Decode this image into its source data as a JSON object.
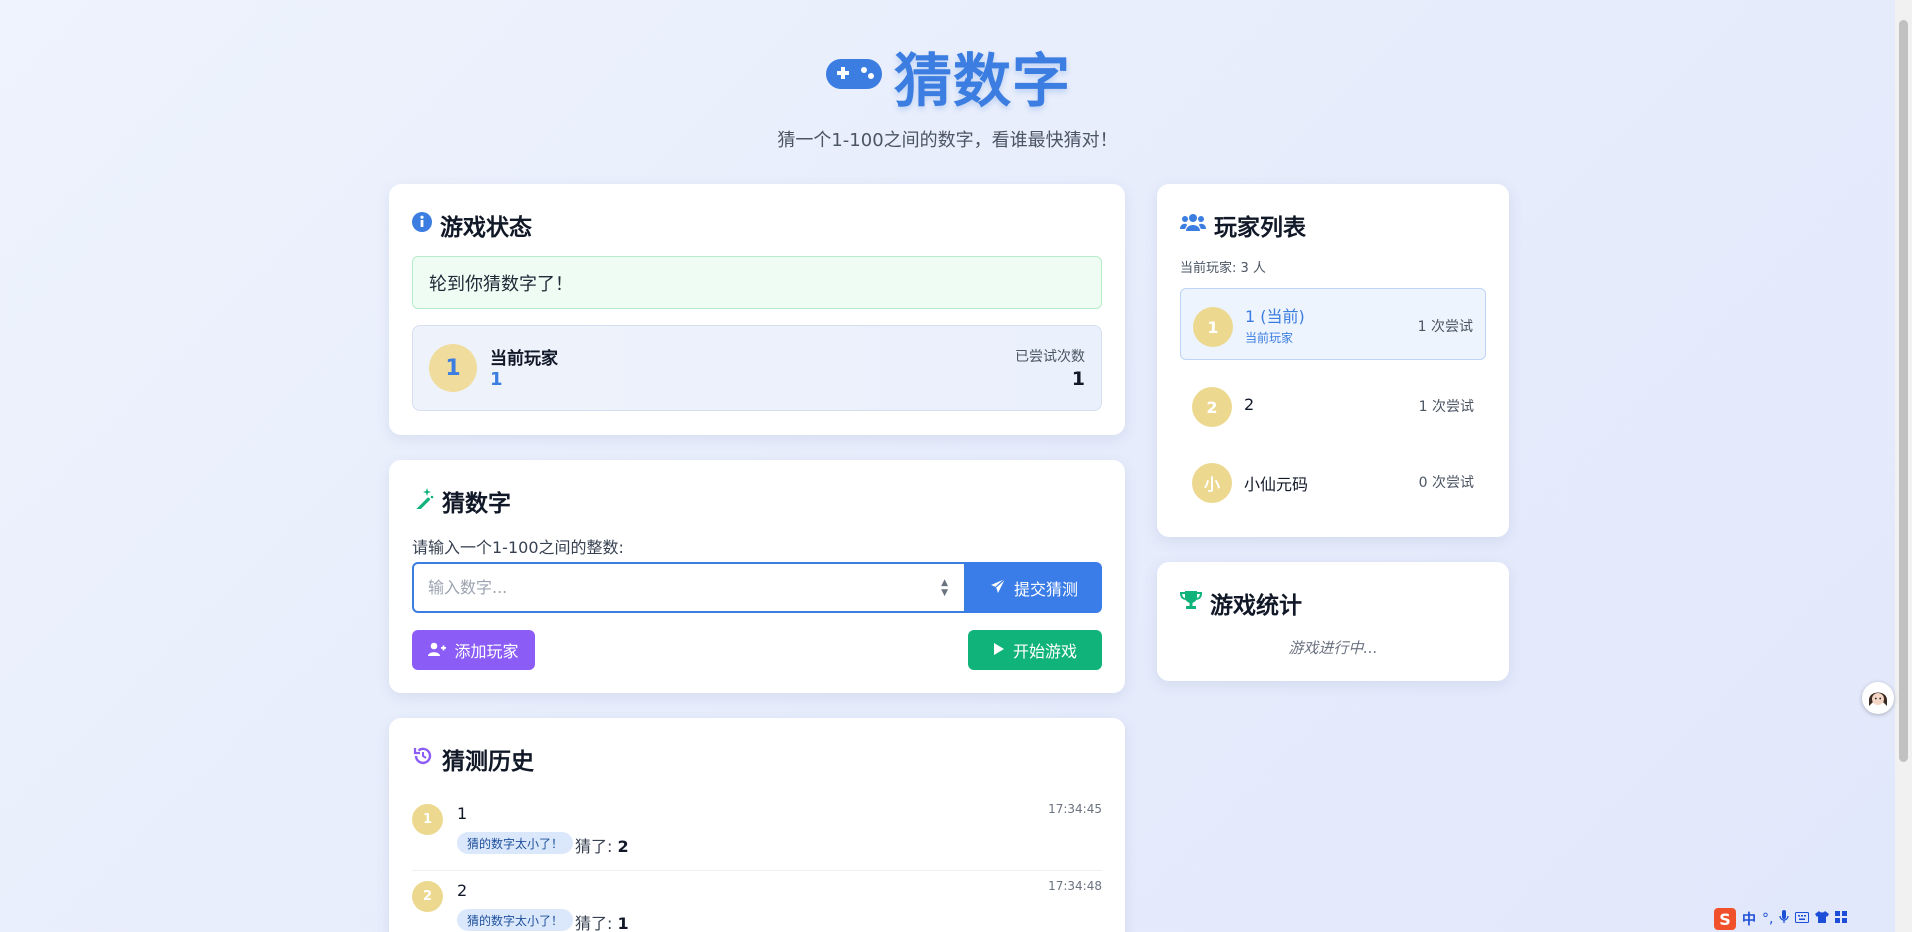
{
  "header": {
    "title": "猜数字",
    "subtitle": "猜一个1-100之间的数字，看谁最快猜对！",
    "icon": "gamepad-icon",
    "accent": "#3b7de0"
  },
  "status": {
    "title": "游戏状态",
    "message": "轮到你猜数字了！",
    "current_label": "当前玩家",
    "current_avatar": "1",
    "current_name": "1",
    "attempts_label": "已尝试次数",
    "attempts_value": "1"
  },
  "guess": {
    "title": "猜数字",
    "label": "请输入一个1-100之间的整数:",
    "placeholder": "输入数字...",
    "submit_label": "提交猜测",
    "add_label": "添加玩家",
    "start_label": "开始游戏"
  },
  "history": {
    "title": "猜测历史",
    "items": [
      {
        "avatar": "1",
        "name": "1",
        "time": "17:34:45",
        "badge": "猜的数字太小了！",
        "guess_label": "猜了:",
        "guess_value": "2"
      },
      {
        "avatar": "2",
        "name": "2",
        "time": "17:34:48",
        "badge": "猜的数字太小了！",
        "guess_label": "猜了:",
        "guess_value": "1"
      }
    ]
  },
  "players": {
    "title": "玩家列表",
    "count_text": "当前玩家: 3 人",
    "items": [
      {
        "avatar": "1",
        "name": "1 (当前)",
        "sub": "当前玩家",
        "attempts": "1 次尝试"
      },
      {
        "avatar": "2",
        "name": "2",
        "attempts": "1 次尝试"
      },
      {
        "avatar": "小",
        "name": "小仙元码",
        "attempts": "0 次尝试"
      }
    ]
  },
  "stats": {
    "title": "游戏统计",
    "text": "游戏进行中..."
  },
  "ime": {
    "logo": "S",
    "lang": "中"
  },
  "colors": {
    "primary": "#3b7de8",
    "purple": "#8b5cf6",
    "green": "#10b37a",
    "avatar_bg": "#f0dc9c"
  }
}
